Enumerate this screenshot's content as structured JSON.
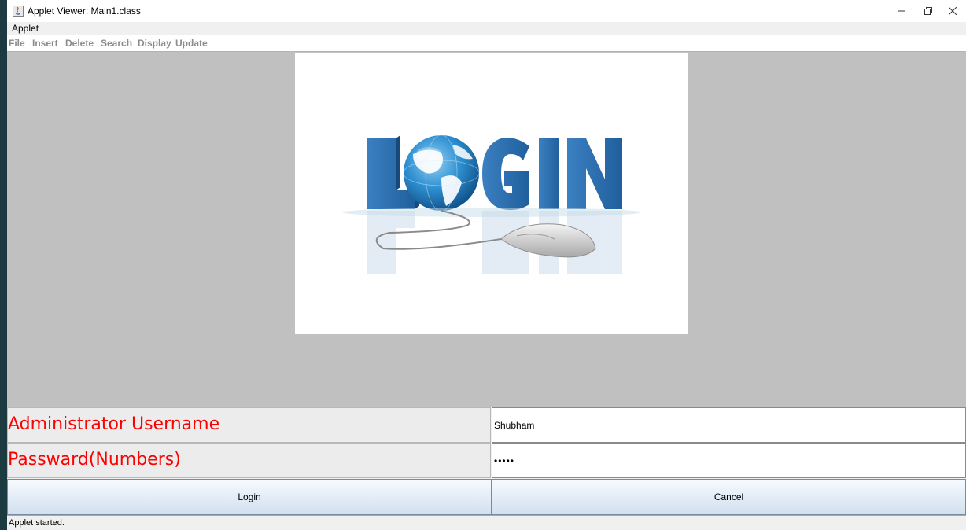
{
  "window": {
    "title": "Applet Viewer: Main1.class"
  },
  "applet_menu": {
    "label": "Applet"
  },
  "menu": {
    "items": [
      "File",
      "Insert",
      "Delete",
      "Search",
      "Display",
      "Update"
    ]
  },
  "form": {
    "username_label": "Administrator Username",
    "password_label": "Passward(Numbers)",
    "username_value": "Shubham",
    "password_value": "•••••",
    "login_label": "Login",
    "cancel_label": "Cancel"
  },
  "status": {
    "text": "Applet started."
  },
  "colors": {
    "label_red": "#ff0000",
    "globe_blue": "#2a78b6",
    "letters_blue": "#2f6fae"
  },
  "icons": {
    "app": "java-applet-icon",
    "minimize": "minimize-icon",
    "restore": "restore-icon",
    "close": "close-icon",
    "globe": "globe-icon",
    "mouse": "computer-mouse-icon"
  }
}
